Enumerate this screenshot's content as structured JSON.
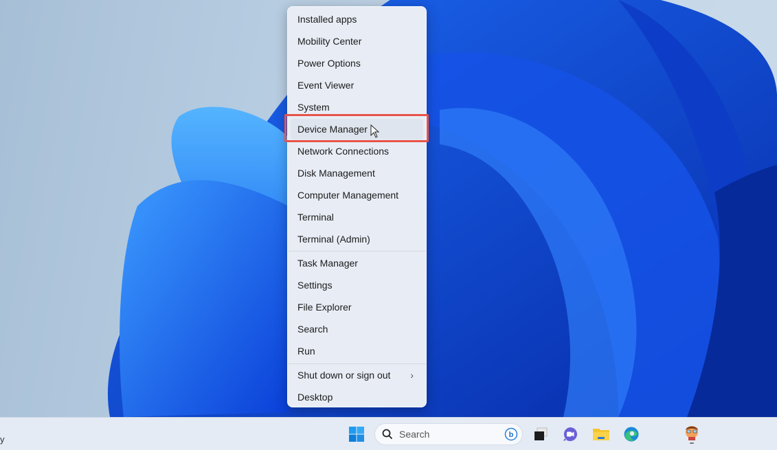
{
  "context_menu": {
    "group1": [
      {
        "label": "Installed apps"
      },
      {
        "label": "Mobility Center"
      },
      {
        "label": "Power Options"
      },
      {
        "label": "Event Viewer"
      },
      {
        "label": "System"
      },
      {
        "label": "Device Manager",
        "highlighted": true
      },
      {
        "label": "Network Connections"
      },
      {
        "label": "Disk Management"
      },
      {
        "label": "Computer Management"
      },
      {
        "label": "Terminal"
      },
      {
        "label": "Terminal (Admin)"
      }
    ],
    "group2": [
      {
        "label": "Task Manager"
      },
      {
        "label": "Settings"
      },
      {
        "label": "File Explorer"
      },
      {
        "label": "Search"
      },
      {
        "label": "Run"
      }
    ],
    "group3": [
      {
        "label": "Shut down or sign out",
        "submenu_indicator": "›"
      },
      {
        "label": "Desktop"
      }
    ]
  },
  "highlight_color": "#e8534a",
  "taskbar": {
    "left_fragment": "y",
    "search_placeholder": "Search",
    "pinned_icons": [
      "windows-start-icon",
      "bing-icon",
      "task-view-icon",
      "teams-chat-icon",
      "file-explorer-icon",
      "edge-icon",
      "avatar-app-icon"
    ]
  }
}
